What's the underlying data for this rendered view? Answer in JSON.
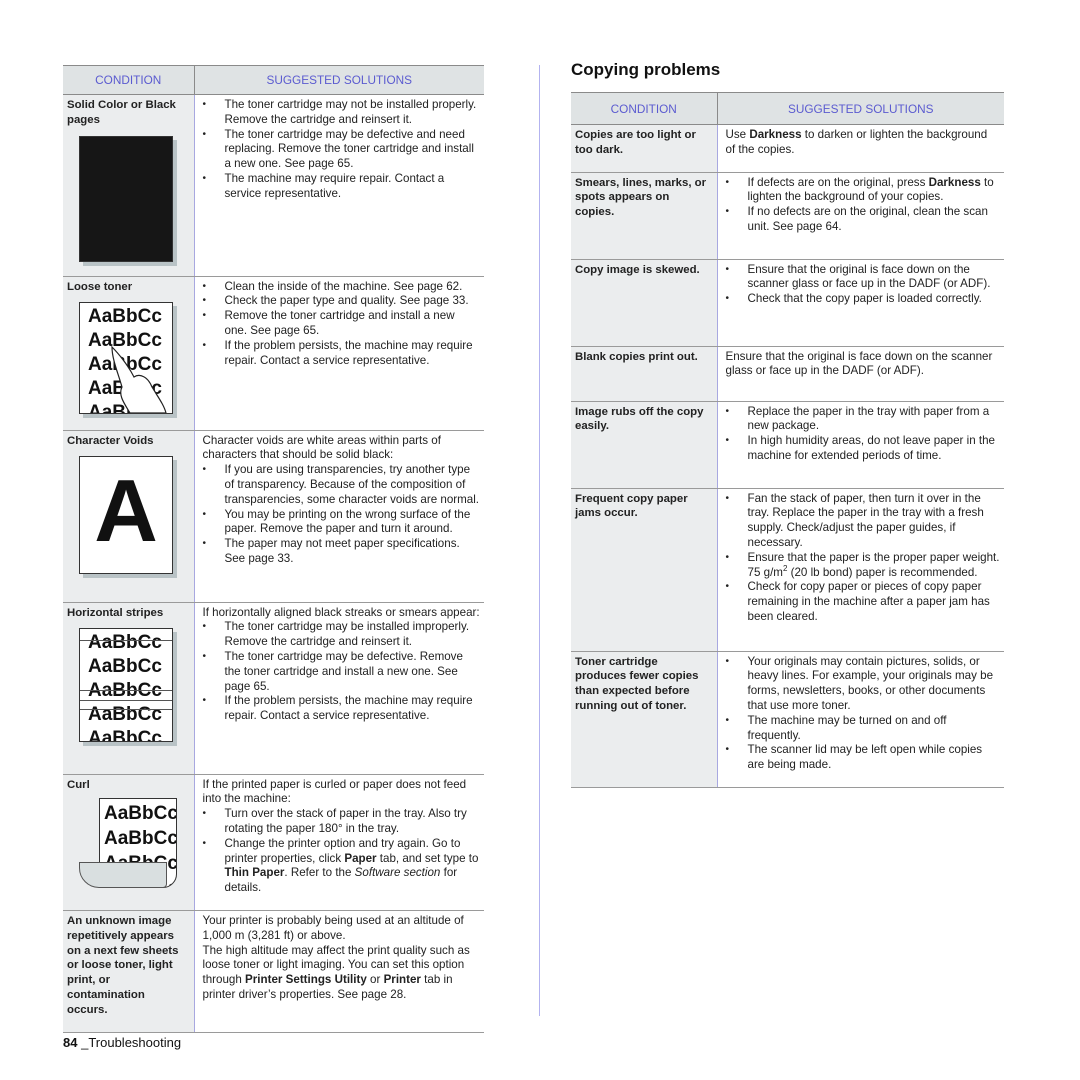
{
  "left_table": {
    "headers": {
      "condition": "CONDITION",
      "solutions": "SUGGESTED SOLUTIONS"
    },
    "rows": [
      {
        "condition": "Solid Color or Black pages",
        "illustration": "black-page-icon",
        "intro": "",
        "bullets": [
          "The toner cartridge may not be installed properly. Remove the cartridge and reinsert it.",
          "The toner cartridge may be defective and need replacing. Remove the toner cartridge and install a new one. See page 65.",
          "The machine may require repair. Contact a service representative."
        ]
      },
      {
        "condition": "Loose toner",
        "illustration": "loose-toner-sample-icon",
        "sample_text": "AaBbCc",
        "intro": "",
        "bullets": [
          "Clean the inside of the machine. See page 62.",
          "Check the paper type and quality. See page 33.",
          "Remove the toner cartridge and install a new one. See page 65.",
          "If the problem persists, the machine may require repair. Contact a service representative."
        ]
      },
      {
        "condition": "Character Voids",
        "illustration": "character-void-icon",
        "sample_text": "A",
        "intro": "Character voids are white areas within parts of characters that should be solid black:",
        "bullets": [
          "If you are using transparencies, try another type of transparency. Because of the composition of transparencies, some character voids are normal.",
          "You may be printing on the wrong surface of the paper. Remove the paper and turn it around.",
          "The paper may not meet paper specifications. See page 33."
        ]
      },
      {
        "condition": "Horizontal stripes",
        "illustration": "horizontal-stripes-icon",
        "sample_text": "AaBbCc",
        "intro": "If horizontally aligned black streaks or smears appear:",
        "bullets": [
          "The toner cartridge may be installed improperly. Remove the cartridge and reinsert it.",
          "The toner cartridge may be defective. Remove the toner cartridge and install a new one. See page 65.",
          "If the problem persists, the machine may require repair. Contact a service representative."
        ]
      },
      {
        "condition": "Curl",
        "illustration": "curled-paper-icon",
        "sample_text": "AaBbCc",
        "intro": "If the printed paper is curled or paper does not feed into the machine:",
        "bullets": [
          "Turn over the stack of paper in the tray. Also try rotating the paper 180° in the tray."
        ],
        "bullet2": {
          "pre": "Change the printer option and try again. Go to printer properties, click ",
          "b1": "Paper",
          "mid": " tab, and set type to ",
          "b2": "Thin Paper",
          "mid2": ". Refer to the ",
          "em": "Software section",
          "post": " for details."
        }
      },
      {
        "condition": "An unknown image repetitively appears on a next few sheets or loose toner, light print, or contamination occurs.",
        "p1": "Your printer is probably being used at an altitude of 1,000 m (3,281 ft) or above.",
        "p2_pre": "The high altitude may affect the print quality such as loose toner or light imaging. You can set this option through ",
        "p2_b1": "Printer Settings Utility",
        "p2_mid": " or ",
        "p2_b2": "Printer",
        "p2_post": " tab in printer driver’s properties. See page 28."
      }
    ]
  },
  "right_section": {
    "title": "Copying problems",
    "headers": {
      "condition": "CONDITION",
      "solutions": "SUGGESTED SOLUTIONS"
    },
    "rows": [
      {
        "condition": "Copies are too light or too dark.",
        "pre": "Use ",
        "b": "Darkness",
        "post": " to darken or lighten the background of the copies."
      },
      {
        "condition": "Smears, lines, marks, or spots appears on copies.",
        "b1_pre": "If defects are on the original, press ",
        "b1_b": "Darkness",
        "b1_post": " to lighten the background of your copies.",
        "b2": "If no defects are on the original, clean the scan unit. See page 64."
      },
      {
        "condition": "Copy image is skewed.",
        "bullets": [
          "Ensure that the original is face down on the scanner glass or face up in the DADF (or ADF).",
          "Check that the copy paper is loaded correctly."
        ]
      },
      {
        "condition": "Blank copies print out.",
        "text": "Ensure that the original is face down on the scanner glass or face up in the DADF (or ADF)."
      },
      {
        "condition": "Image rubs off the copy easily.",
        "bullets": [
          "Replace the paper in the tray with paper from a new package.",
          "In high humidity areas, do not leave paper in the machine for extended periods of time."
        ]
      },
      {
        "condition": "Frequent copy paper jams occur.",
        "b1": "Fan the stack of paper, then turn it over in the tray. Replace the paper in the tray with a fresh supply. Check/adjust the paper guides, if necessary.",
        "b2_pre": "Ensure that the paper is the proper paper weight. 75 g/m",
        "b2_sup": "2",
        "b2_post": " (20 lb bond) paper is recommended.",
        "b3": "Check for copy paper or pieces of copy paper remaining in the machine after a paper jam has been cleared."
      },
      {
        "condition": "Toner cartridge produces fewer copies than expected before running out of toner.",
        "bullets": [
          "Your originals may contain pictures, solids, or heavy lines. For example, your originals may be forms, newsletters, books, or other documents that use more toner.",
          "The machine may be turned on and off frequently.",
          "The scanner lid may be left open while copies are being made."
        ]
      }
    ]
  },
  "footer": {
    "page_number": "84",
    "section": "_Troubleshooting"
  },
  "colors": {
    "header_text": "#5b5bd0",
    "header_bg": "#dfe3e4",
    "condition_bg": "#ebedee",
    "divider": "#b3b3f0"
  }
}
